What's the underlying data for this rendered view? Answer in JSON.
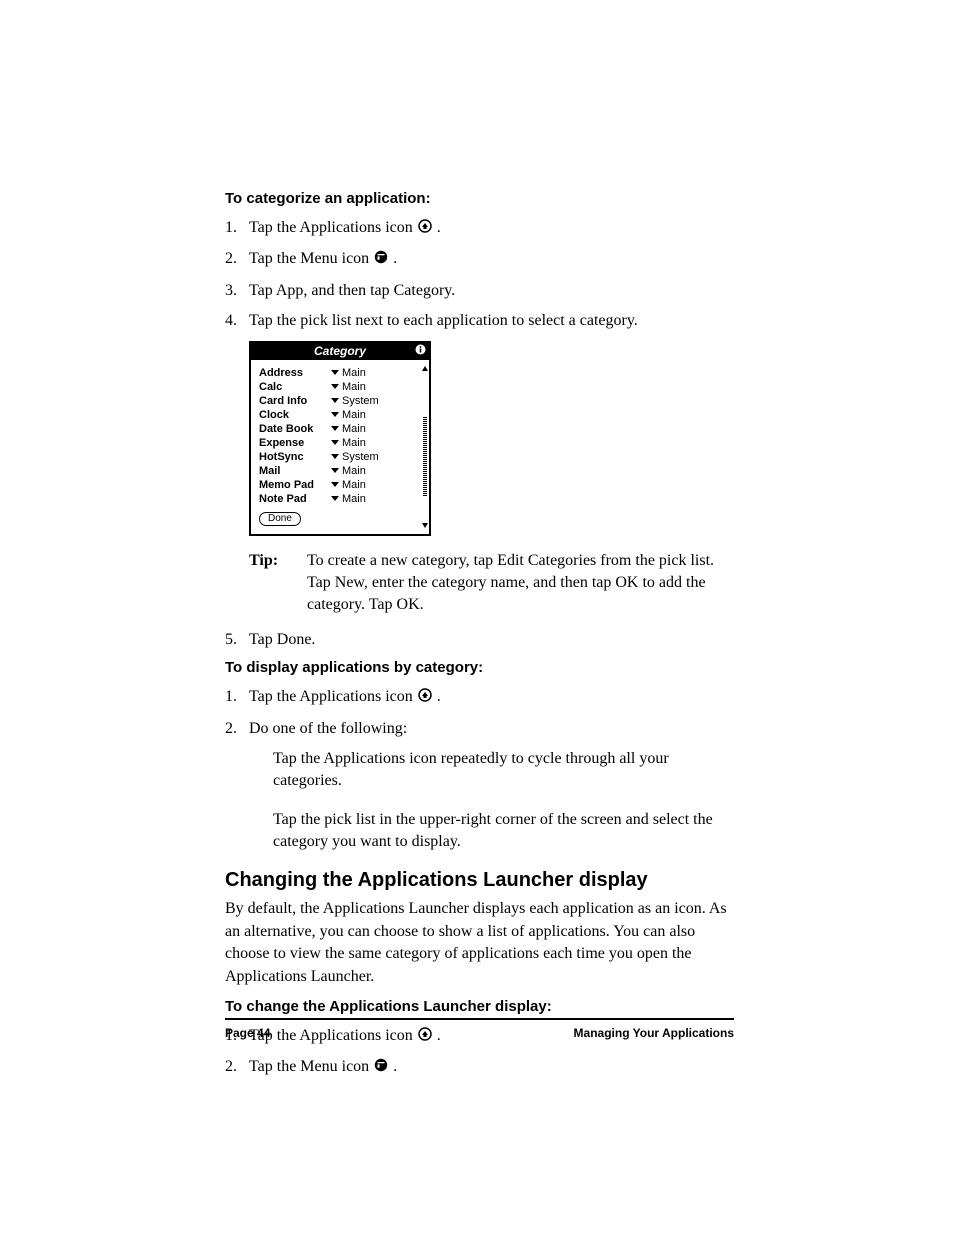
{
  "sections": {
    "s1": {
      "heading": "To categorize an application:",
      "steps": {
        "n1": "1.",
        "t1a": "Tap the Applications icon ",
        "t1b": ".",
        "n2": "2.",
        "t2a": "Tap the Menu icon ",
        "t2b": ".",
        "n3": "3.",
        "t3": "Tap App, and then tap Category.",
        "n4": "4.",
        "t4": "Tap the pick list next to each application to select a category.",
        "n5": "5.",
        "t5": "Tap Done."
      },
      "tip_label": "Tip:",
      "tip_text": "To create a new category, tap Edit Categories from the pick list. Tap New, enter the category name, and then tap OK to add the category. Tap OK."
    },
    "s2": {
      "heading": "To display applications by category:",
      "steps": {
        "n1": "1.",
        "t1a": "Tap the Applications icon ",
        "t1b": ".",
        "n2": "2.",
        "t2": "Do one of the following:"
      },
      "sub1": "Tap the Applications icon repeatedly to cycle through all your categories.",
      "sub2": "Tap the pick list in the upper-right corner of the screen and select the category you want to display."
    },
    "s3": {
      "title": "Changing the Applications Launcher display",
      "body": "By default, the Applications Launcher displays each application as an icon. As an alternative, you can choose to show a list of applications. You can also choose to view the same category of applications each time you open the Applications Launcher.",
      "heading": "To change the Applications Launcher display:",
      "steps": {
        "n1": "1.",
        "t1a": "Tap the Applications icon ",
        "t1b": ".",
        "n2": "2.",
        "t2a": "Tap the Menu icon ",
        "t2b": "."
      }
    }
  },
  "screenshot": {
    "title": "Category",
    "rows": [
      {
        "app": "Address",
        "cat": "Main"
      },
      {
        "app": "Calc",
        "cat": "Main"
      },
      {
        "app": "Card Info",
        "cat": "System"
      },
      {
        "app": "Clock",
        "cat": "Main"
      },
      {
        "app": "Date Book",
        "cat": "Main"
      },
      {
        "app": "Expense",
        "cat": "Main"
      },
      {
        "app": "HotSync",
        "cat": "System"
      },
      {
        "app": "Mail",
        "cat": "Main"
      },
      {
        "app": "Memo Pad",
        "cat": "Main"
      },
      {
        "app": "Note Pad",
        "cat": "Main"
      }
    ],
    "done": "Done"
  },
  "footer": {
    "left": "Page 44",
    "right": "Managing Your Applications"
  }
}
